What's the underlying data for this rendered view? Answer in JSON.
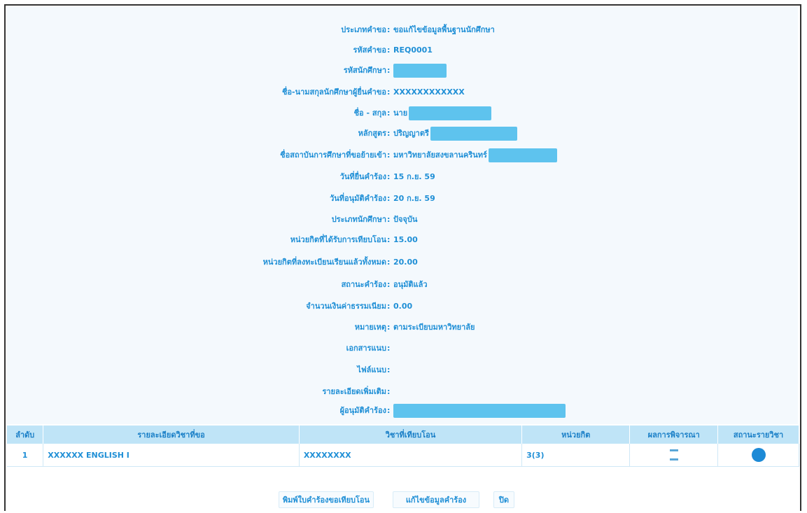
{
  "form": {
    "fields": [
      {
        "label": "ประเภทคำขอ",
        "value": "ขอแก้ไขข้อมูลพื้นฐานนักศึกษา"
      },
      {
        "label": "รหัสคำขอ",
        "value": "REQ0001"
      },
      {
        "label": "รหัสนักศึกษา",
        "value": "",
        "chip_width": 76
      },
      {
        "label": "ชื่อ-นามสกุลนักศึกษาผู้ยื่นคำขอ",
        "value": "XXXXXXXXXXXX"
      },
      {
        "label": "ชื่อ - สกุล",
        "value": "นาย",
        "chip_width": 118
      },
      {
        "label": "หลักสูตร",
        "value": "ปริญญาตรี",
        "chip_width": 124
      },
      {
        "label": "ชื่อสถาบันการศึกษาที่ขอย้ายเข้า",
        "value": "มหาวิทยาลัยสงขลานครินทร์",
        "chip_width": 98
      },
      {
        "label": "วันที่ยื่นคำร้อง",
        "value": "15 ก.ย. 59"
      },
      {
        "label": "วันที่อนุมัติคำร้อง",
        "value": "20 ก.ย. 59"
      },
      {
        "label": "ประเภทนักศึกษา",
        "value": "ปัจจุบัน"
      },
      {
        "label": "หน่วยกิตที่ได้รับการเทียบโอน",
        "value": "15.00"
      },
      {
        "label": "หน่วยกิตที่ลงทะเบียนเรียนแล้วทั้งหมด",
        "value": "20.00"
      },
      {
        "label": "สถานะคำร้อง",
        "value": "อนุมัติแล้ว"
      },
      {
        "label": "จำนวนเงินค่าธรรมเนียม",
        "value": "0.00"
      },
      {
        "label": "หมายเหตุ",
        "value": "ตามระเบียบมหาวิทยาลัย"
      },
      {
        "label": "เอกสารแนบ",
        "value": ""
      },
      {
        "label": "ไฟล์แนบ",
        "value": ""
      },
      {
        "label": "รายละเอียดเพิ่มเติม",
        "value": ""
      },
      {
        "label": "ผู้อนุมัติคำร้อง",
        "value": "",
        "chip_width": 246
      }
    ]
  },
  "table": {
    "headers": [
      "ลำดับ",
      "รายละเอียดวิชาที่ขอ",
      "วิชาที่เทียบโอน",
      "หน่วยกิต",
      "ผลการพิจารณา",
      "สถานะรายวิชา"
    ],
    "rows": [
      {
        "no": "1",
        "subject": "XXXXXX ENGLISH I",
        "transfer": "XXXXXXXX",
        "credit": "3(3)",
        "result": "",
        "status": ""
      }
    ]
  },
  "buttons": {
    "print_label": "พิมพ์ใบคำร้องขอเทียบโอน",
    "edit_label": "แก้ไขข้อมูลคำร้อง",
    "close_label": "ปิด"
  }
}
